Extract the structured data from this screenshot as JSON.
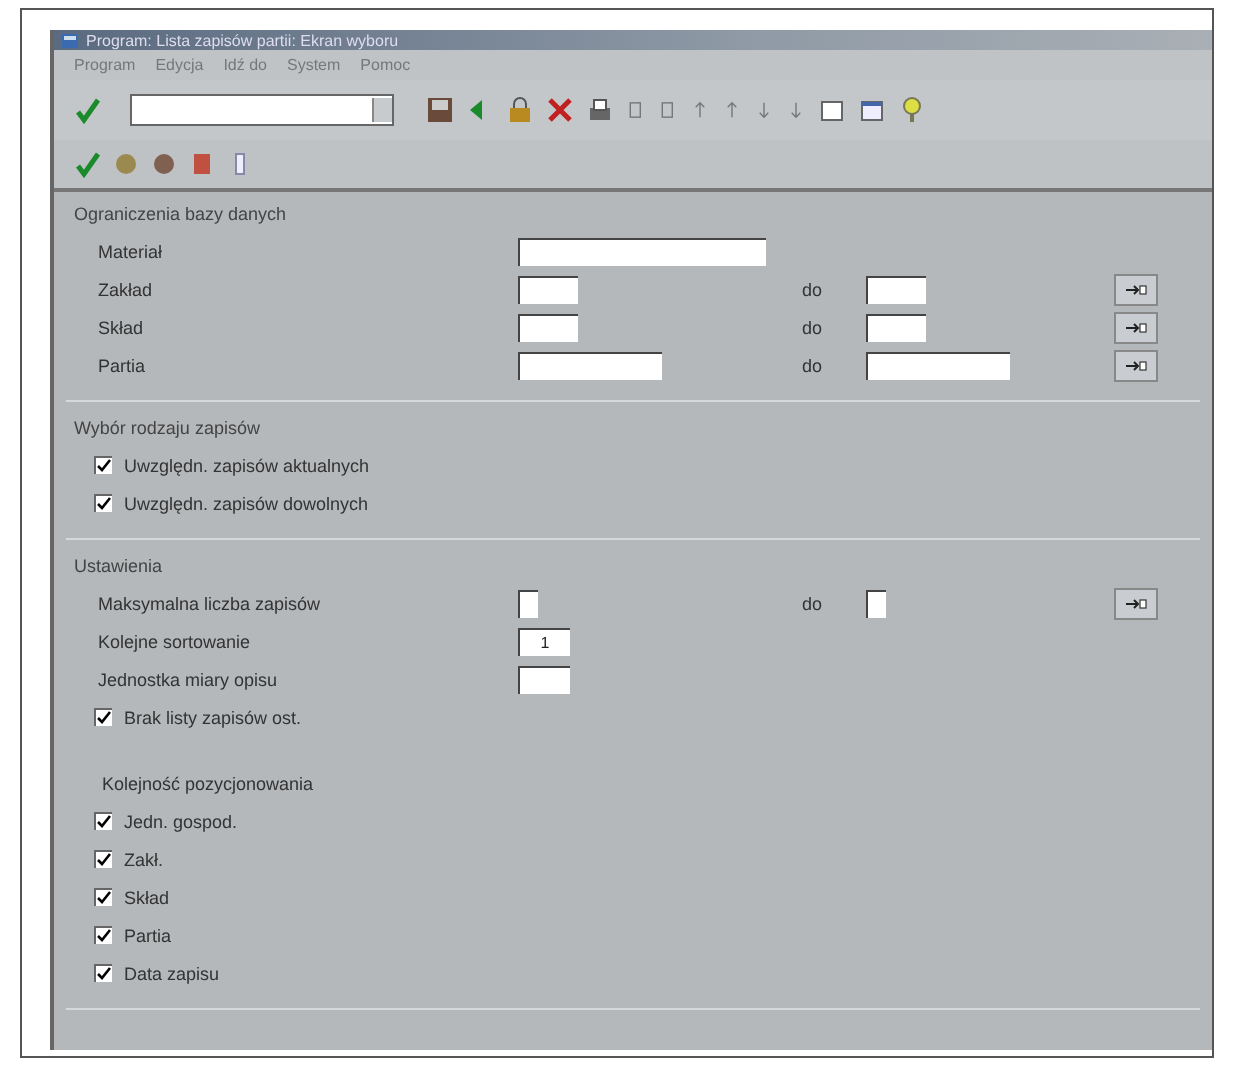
{
  "window": {
    "title": "Program: Lista zapisów partii: Ekran wyboru"
  },
  "menu": [
    "Program",
    "Edycja",
    "Idź do",
    "System",
    "Pomoc"
  ],
  "groups": [
    {
      "title": "Ograniczenia bazy danych",
      "rows": [
        {
          "kind": "range",
          "label": "Materiał",
          "multi": false
        },
        {
          "kind": "range",
          "label": "Zakład",
          "to_label": "do",
          "multi": true
        },
        {
          "kind": "range",
          "label": "Skład",
          "to_label": "do",
          "multi": true
        },
        {
          "kind": "range",
          "label": "Partia",
          "to_label": "do",
          "multi": true
        }
      ]
    },
    {
      "title": "Wybór rodzaju zapisów",
      "rows": [
        {
          "kind": "check",
          "label": "Uwzględn. zapisów aktualnych",
          "checked": true
        },
        {
          "kind": "check",
          "label": "Uwzględn. zapisów dowolnych",
          "checked": true
        }
      ]
    },
    {
      "title": "Ustawienia",
      "rows": [
        {
          "kind": "range",
          "label": "Maksymalna liczba zapisów",
          "to_label": "do",
          "multi": true
        },
        {
          "kind": "range",
          "label": "Kolejne sortowanie",
          "value": "1",
          "multi": false
        },
        {
          "kind": "range",
          "label": "Jednostka miary opisu",
          "multi": false
        },
        {
          "kind": "check",
          "label": "Brak listy zapisów ost.",
          "checked": true
        },
        {
          "kind": "gap"
        },
        {
          "kind": "heading",
          "label": "Kolejność pozycjonowania"
        },
        {
          "kind": "check",
          "label": "Jedn. gospod.",
          "checked": true
        },
        {
          "kind": "check",
          "label": "Zakł.",
          "checked": true
        },
        {
          "kind": "check",
          "label": "Skład",
          "checked": true
        },
        {
          "kind": "check",
          "label": "Partia",
          "checked": true
        },
        {
          "kind": "check",
          "label": "Data zapisu",
          "checked": true
        }
      ]
    }
  ]
}
